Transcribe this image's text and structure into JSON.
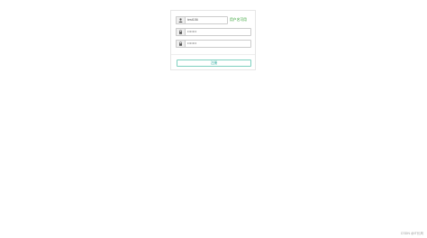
{
  "form": {
    "username": {
      "value": "test156",
      "icon": "user-icon",
      "status": "用户名可用",
      "status_color": "#2e9e2e"
    },
    "password": {
      "value": "•••••••",
      "icon": "lock-icon"
    },
    "confirm_password": {
      "value": "•••••••",
      "icon": "lock-icon"
    },
    "submit_label": "注册"
  },
  "watermark": "CSDN @IT长风"
}
